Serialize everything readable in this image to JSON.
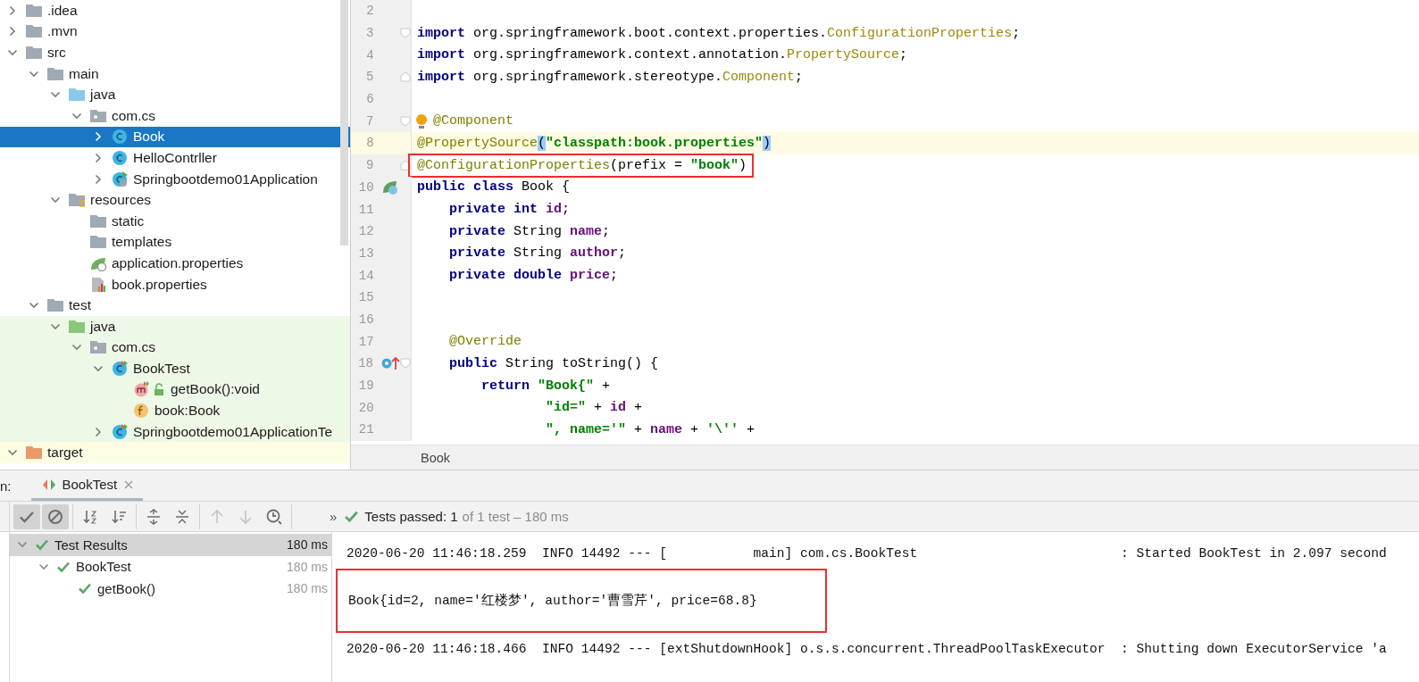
{
  "project_tree": {
    "items": [
      {
        "label": ".idea",
        "kind": "folder",
        "expanded": false,
        "selected": false
      },
      {
        "label": ".mvn",
        "kind": "folder",
        "expanded": false,
        "selected": false
      },
      {
        "label": "src",
        "kind": "folder",
        "expanded": true,
        "selected": false,
        "children": [
          {
            "label": "main",
            "kind": "folder",
            "expanded": true,
            "selected": false,
            "children": [
              {
                "label": "java",
                "kind": "source-folder",
                "expanded": true,
                "selected": false,
                "children": [
                  {
                    "label": "com.cs",
                    "kind": "package",
                    "expanded": true,
                    "selected": false,
                    "children": [
                      {
                        "label": "Book",
                        "kind": "class",
                        "expanded": false,
                        "selected": true
                      },
                      {
                        "label": "HelloContrller",
                        "kind": "class",
                        "expanded": false,
                        "selected": false
                      },
                      {
                        "label": "Springbootdemo01Application",
                        "kind": "spring-class",
                        "expanded": false,
                        "selected": false
                      }
                    ]
                  }
                ]
              },
              {
                "label": "resources",
                "kind": "resources-folder",
                "expanded": true,
                "selected": false,
                "children": [
                  {
                    "label": "static",
                    "kind": "folder",
                    "selected": false
                  },
                  {
                    "label": "templates",
                    "kind": "folder",
                    "selected": false
                  },
                  {
                    "label": "application.properties",
                    "kind": "spring-properties",
                    "selected": false
                  },
                  {
                    "label": "book.properties",
                    "kind": "properties",
                    "selected": false
                  }
                ]
              }
            ]
          },
          {
            "label": "test",
            "kind": "folder",
            "expanded": true,
            "selected": false,
            "children": [
              {
                "label": "java",
                "kind": "test-folder",
                "expanded": true,
                "selected": false,
                "test_scope": true,
                "children": [
                  {
                    "label": "com.cs",
                    "kind": "package",
                    "expanded": true,
                    "selected": false,
                    "test_scope": true,
                    "children": [
                      {
                        "label": "BookTest",
                        "kind": "test-class",
                        "expanded": true,
                        "selected": false,
                        "test_scope": true,
                        "children": [
                          {
                            "label": "getBook():void",
                            "kind": "method",
                            "selected": false,
                            "test_scope": true,
                            "public": true
                          },
                          {
                            "label": "book:Book",
                            "kind": "field",
                            "selected": false,
                            "test_scope": true
                          }
                        ]
                      },
                      {
                        "label": "Springbootdemo01ApplicationTe",
                        "kind": "test-class",
                        "expanded": false,
                        "selected": false,
                        "test_scope": true
                      }
                    ]
                  }
                ]
              }
            ]
          }
        ]
      },
      {
        "label": "target",
        "kind": "excluded-folder",
        "expanded": true,
        "selected": false,
        "excluded": true
      }
    ]
  },
  "editor": {
    "lines": [
      {
        "number": "2"
      },
      {
        "number": "3",
        "fold_open": true,
        "tokens": [
          {
            "t": "import",
            "kind": "kw"
          },
          {
            "t": " org.springframework.boot.context.properties.",
            "kind": "plain"
          },
          {
            "t": "ConfigurationProperties",
            "kind": "cls"
          },
          {
            "t": ";",
            "kind": "plain"
          }
        ]
      },
      {
        "number": "4",
        "tokens": [
          {
            "t": "import",
            "kind": "kw"
          },
          {
            "t": " org.springframework.context.annotation.",
            "kind": "plain"
          },
          {
            "t": "PropertySource",
            "kind": "cls"
          },
          {
            "t": ";",
            "kind": "plain"
          }
        ]
      },
      {
        "number": "5",
        "fold_close": true,
        "tokens": [
          {
            "t": "import",
            "kind": "kw"
          },
          {
            "t": " org.springframework.stereotype.",
            "kind": "plain"
          },
          {
            "t": "Component",
            "kind": "cls"
          },
          {
            "t": ";",
            "kind": "plain"
          }
        ]
      },
      {
        "number": "6"
      },
      {
        "number": "7",
        "fold_open": true,
        "intention": true,
        "tokens": [
          {
            "t": "@Component",
            "kind": "ann"
          }
        ]
      },
      {
        "number": "8",
        "current": true,
        "tokens": [
          {
            "t": "@PropertySource",
            "kind": "ann"
          },
          {
            "t": "(",
            "kind": "match"
          },
          {
            "t": "\"classpath:book.properties\"",
            "kind": "str"
          },
          {
            "t": ")",
            "kind": "match"
          }
        ]
      },
      {
        "number": "9",
        "fold_close": true,
        "boxed": true,
        "tokens": [
          {
            "t": "@ConfigurationProperties",
            "kind": "ann"
          },
          {
            "t": "(prefix = ",
            "kind": "plain"
          },
          {
            "t": "\"book\"",
            "kind": "str"
          },
          {
            "t": ")",
            "kind": "plain"
          }
        ]
      },
      {
        "number": "10",
        "bean": true,
        "tokens": [
          {
            "t": "public class",
            "kind": "kw"
          },
          {
            "t": " Book {",
            "kind": "plain"
          }
        ]
      },
      {
        "number": "11",
        "tokens": [
          {
            "t": "    private int",
            "kind": "kw"
          },
          {
            "t": " id",
            "kind": "field"
          },
          {
            "t": ";",
            "kind": "plain"
          }
        ]
      },
      {
        "number": "12",
        "tokens": [
          {
            "t": "    private",
            "kind": "kw"
          },
          {
            "t": " String ",
            "kind": "plain"
          },
          {
            "t": "name",
            "kind": "field"
          },
          {
            "t": ";",
            "kind": "plain"
          }
        ]
      },
      {
        "number": "13",
        "tokens": [
          {
            "t": "    private",
            "kind": "kw"
          },
          {
            "t": " String ",
            "kind": "plain"
          },
          {
            "t": "author",
            "kind": "field"
          },
          {
            "t": ";",
            "kind": "plain"
          }
        ]
      },
      {
        "number": "14",
        "tokens": [
          {
            "t": "    private double",
            "kind": "kw"
          },
          {
            "t": " price",
            "kind": "field"
          },
          {
            "t": ";",
            "kind": "plain"
          }
        ]
      },
      {
        "number": "15"
      },
      {
        "number": "16"
      },
      {
        "number": "17",
        "tokens": [
          {
            "t": "    @Override",
            "kind": "ann"
          }
        ]
      },
      {
        "number": "18",
        "fold_open": true,
        "overrides": true,
        "tokens": [
          {
            "t": "    public",
            "kind": "kw"
          },
          {
            "t": " String toString() {",
            "kind": "plain"
          }
        ]
      },
      {
        "number": "19",
        "tokens": [
          {
            "t": "        return",
            "kind": "kw"
          },
          {
            "t": " \"Book{\"",
            "kind": "str"
          },
          {
            "t": " +",
            "kind": "plain"
          }
        ]
      },
      {
        "number": "20",
        "tokens": [
          {
            "t": "                \"id=\"",
            "kind": "str"
          },
          {
            "t": " + ",
            "kind": "plain"
          },
          {
            "t": "id",
            "kind": "field"
          },
          {
            "t": " +",
            "kind": "plain"
          }
        ]
      },
      {
        "number": "21",
        "tokens": [
          {
            "t": "                \", name='\"",
            "kind": "str"
          },
          {
            "t": " + ",
            "kind": "plain"
          },
          {
            "t": "name",
            "kind": "field"
          },
          {
            "t": " + ",
            "kind": "plain"
          },
          {
            "t": "'\\''",
            "kind": "str"
          },
          {
            "t": " +",
            "kind": "plain"
          }
        ]
      }
    ],
    "breadcrumb": "Book"
  },
  "run_panel": {
    "label": "n:",
    "tabs": [
      {
        "label": "BookTest",
        "selected": true
      }
    ],
    "toolbar": [
      [
        {
          "kind": "check",
          "selected": true,
          "disabled": false
        },
        {
          "kind": "ignored",
          "selected": true,
          "disabled": false
        }
      ],
      [
        {
          "kind": "sort-alpha",
          "selected": false,
          "disabled": false
        },
        {
          "kind": "sort-duration",
          "selected": false,
          "disabled": false
        }
      ],
      [
        {
          "kind": "expand-all",
          "selected": false,
          "disabled": false
        },
        {
          "kind": "collapse-all",
          "selected": false,
          "disabled": false
        }
      ],
      [
        {
          "kind": "up",
          "selected": false,
          "disabled": true
        },
        {
          "kind": "down",
          "selected": false,
          "disabled": true
        },
        {
          "kind": "history",
          "selected": false,
          "disabled": false
        }
      ]
    ],
    "overflow": "»",
    "status": {
      "passed": true,
      "title": "Tests passed: 1",
      "detail": "of 1 test – 180 ms"
    },
    "test_tree": [
      {
        "name": "Test Results",
        "time": "180 ms",
        "passed": true,
        "expanded": true,
        "selected": true,
        "children": [
          {
            "name": "BookTest",
            "time": "180 ms",
            "passed": true,
            "expanded": true,
            "selected": false,
            "children": [
              {
                "name": "getBook()",
                "time": "180 ms",
                "passed": true,
                "selected": false
              }
            ]
          }
        ]
      }
    ],
    "console": [
      {
        "text": "2020-06-20 11:46:18.259  INFO 14492 --- [           main] com.cs.BookTest                          : Started BookTest in 2.097 second",
        "boxed": false
      },
      {
        "text": "Book{id=2, name='红楼梦', author='曹雪芹', price=68.8}",
        "boxed": true
      },
      {
        "text": "2020-06-20 11:46:18.466  INFO 14492 --- [extShutdownHook] o.s.s.concurrent.ThreadPoolTaskExecutor  : Shutting down ExecutorService 'a",
        "boxed": false
      }
    ]
  }
}
